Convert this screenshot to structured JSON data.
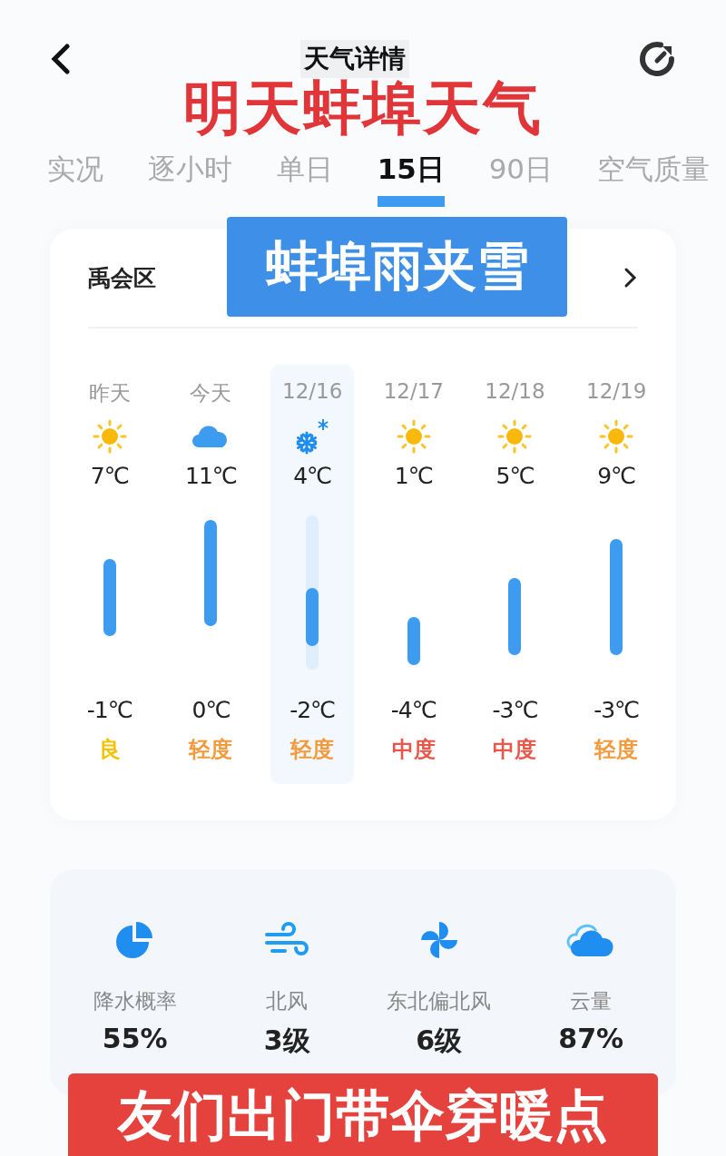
{
  "header": {
    "title": "天气详情"
  },
  "caption_top": "明天蚌埠天气",
  "tabs": [
    {
      "label": "实况",
      "selected": false
    },
    {
      "label": "逐小时",
      "selected": false
    },
    {
      "label": "单日",
      "selected": false
    },
    {
      "label": "15日",
      "selected": true
    },
    {
      "label": "90日",
      "selected": false
    },
    {
      "label": "空气质量",
      "selected": false
    }
  ],
  "forecast": {
    "location": "禹会区",
    "caption": "蚌埠雨夹雪",
    "days": [
      {
        "date": "昨天",
        "kind": "sunny",
        "high": "7℃",
        "low": "-1℃",
        "air": "良",
        "color": "#f5c400",
        "selected": false
      },
      {
        "date": "今天",
        "kind": "cloudy",
        "high": "11℃",
        "low": "0℃",
        "air": "轻度",
        "color": "#f39a3c",
        "selected": false
      },
      {
        "date": "12/16",
        "kind": "snow",
        "high": "4℃",
        "low": "-2℃",
        "air": "轻度",
        "color": "#f39a3c",
        "selected": true
      },
      {
        "date": "12/17",
        "kind": "sunny",
        "high": "1℃",
        "low": "-4℃",
        "air": "中度",
        "color": "#e8574a",
        "selected": false
      },
      {
        "date": "12/18",
        "kind": "sunny",
        "high": "5℃",
        "low": "-3℃",
        "air": "中度",
        "color": "#e8574a",
        "selected": false
      },
      {
        "date": "12/19",
        "kind": "sunny",
        "high": "9℃",
        "low": "-3℃",
        "air": "轻度",
        "color": "#f39a3c",
        "selected": false
      }
    ]
  },
  "details": [
    {
      "kind": "rain",
      "label": "降水概率",
      "value": "55%"
    },
    {
      "kind": "wind",
      "label": "北风",
      "value": "3级"
    },
    {
      "kind": "fan",
      "label": "东北偏北风",
      "value": "6级"
    },
    {
      "kind": "cloud",
      "label": "云量",
      "value": "87%"
    }
  ],
  "caption_bottom": "友们出门带伞穿暖点"
}
